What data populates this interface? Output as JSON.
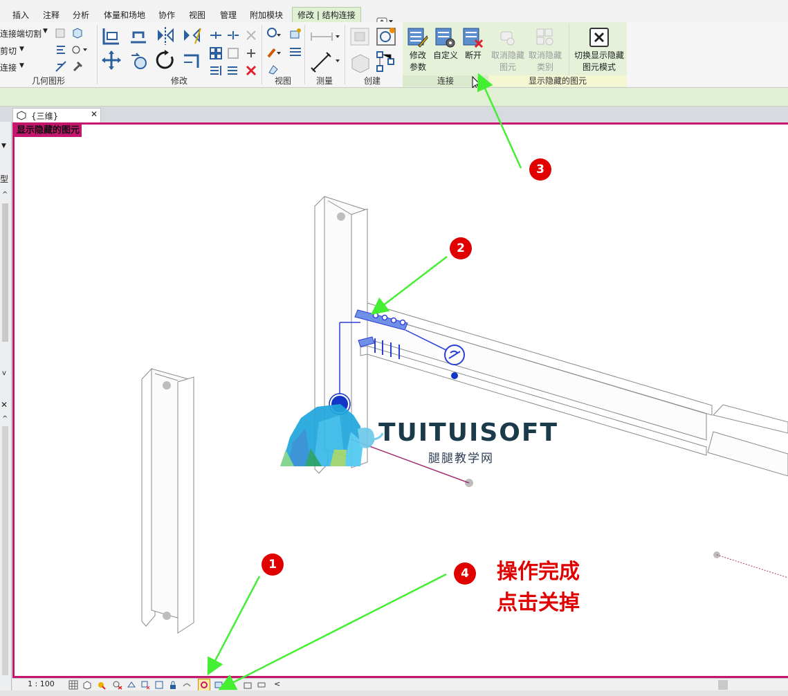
{
  "tabs": [
    "插入",
    "注释",
    "分析",
    "体量和场地",
    "协作",
    "视图",
    "管理",
    "附加模块"
  ],
  "active_tab": "修改 | 结构连接",
  "geometry_panel": {
    "items": [
      "连接端切割",
      "剪切",
      "连接"
    ],
    "label": "几何图形"
  },
  "panels": {
    "modify": "修改",
    "view": "视图",
    "measure": "测量",
    "create": "创建",
    "connection": "连接",
    "reveal": "显示隐藏的图元"
  },
  "connection_buttons": {
    "modify_params": [
      "修改",
      "参数"
    ],
    "custom": "自定义",
    "disconnect": "断开"
  },
  "reveal_buttons": {
    "unhide_element": [
      "取消隐藏",
      "图元"
    ],
    "unhide_category": [
      "取消隐藏",
      "类别"
    ],
    "toggle": [
      "切换显示隐藏",
      "图元模式"
    ]
  },
  "view_tab": {
    "title": "{三维}"
  },
  "left_panel_text": "型",
  "canvas": {
    "banner": "显示隐藏的图元"
  },
  "statusbar": {
    "scale": "1 : 100"
  },
  "watermark": {
    "brand": "TUITUISOFT",
    "sub": "腿腿教学网"
  },
  "callouts": [
    "1",
    "2",
    "3",
    "4"
  ],
  "note": [
    "操作完成",
    "点击关掉"
  ],
  "colors": {
    "reveal_frame": "#c4166d",
    "callout": "#e00000",
    "arrow": "#44ee33",
    "ribbon_context": "#dff0d3",
    "connection_blue": "#2a3fd8"
  }
}
